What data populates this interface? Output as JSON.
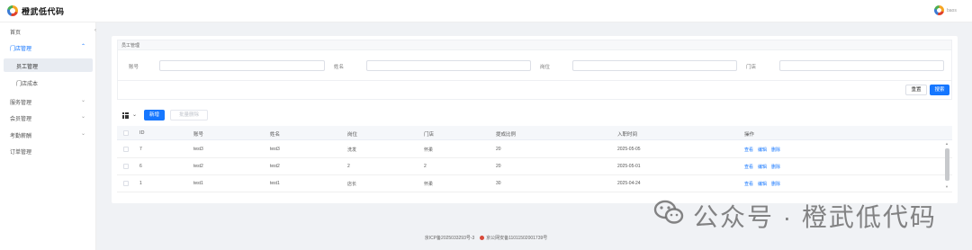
{
  "header": {
    "brand": "橙武低代码",
    "username": "baos"
  },
  "sidebar": {
    "items": [
      {
        "label": "首页"
      },
      {
        "label": "门店管理",
        "expanded": true
      },
      {
        "label": "员工管理",
        "selected": true
      },
      {
        "label": "门店成本"
      },
      {
        "label": "服务管理"
      },
      {
        "label": "会员管理"
      },
      {
        "label": "考勤薪酬"
      },
      {
        "label": "订单管理"
      }
    ]
  },
  "card": {
    "title": "员工管理"
  },
  "search": {
    "fields": [
      {
        "label": "账号",
        "value": ""
      },
      {
        "label": "姓名",
        "value": ""
      },
      {
        "label": "岗位",
        "value": ""
      },
      {
        "label": "门店",
        "value": ""
      }
    ],
    "reset_label": "重置",
    "search_label": "搜索"
  },
  "toolbar": {
    "add_label": "新增",
    "batch_delete_label": "批量删除"
  },
  "table": {
    "columns": [
      "ID",
      "账号",
      "姓名",
      "岗位",
      "门店",
      "提成比例",
      "入职时间",
      "操作"
    ],
    "rows": [
      {
        "id": "7",
        "account": "test3",
        "name": "test3",
        "position": "洗发",
        "store": "怀柔",
        "commission": "20",
        "hire_date": "2025-05-05"
      },
      {
        "id": "6",
        "account": "test2",
        "name": "test2",
        "position": "2",
        "store": "2",
        "commission": "20",
        "hire_date": "2025-05-01"
      },
      {
        "id": "1",
        "account": "test1",
        "name": "test1",
        "position": "店长",
        "store": "怀柔",
        "commission": "30",
        "hire_date": "2025-04-24"
      }
    ],
    "actions": [
      "查看",
      "编辑",
      "删除"
    ]
  },
  "footer": {
    "icp": "京ICP备2025033293号-3",
    "police": "京公网安备11011502001739号"
  },
  "watermark": {
    "text": "公众号 · 橙武低代码"
  },
  "colors": {
    "primary": "#1677ff",
    "background": "#f0f2f5",
    "sidebar_bg": "#ffffff"
  }
}
